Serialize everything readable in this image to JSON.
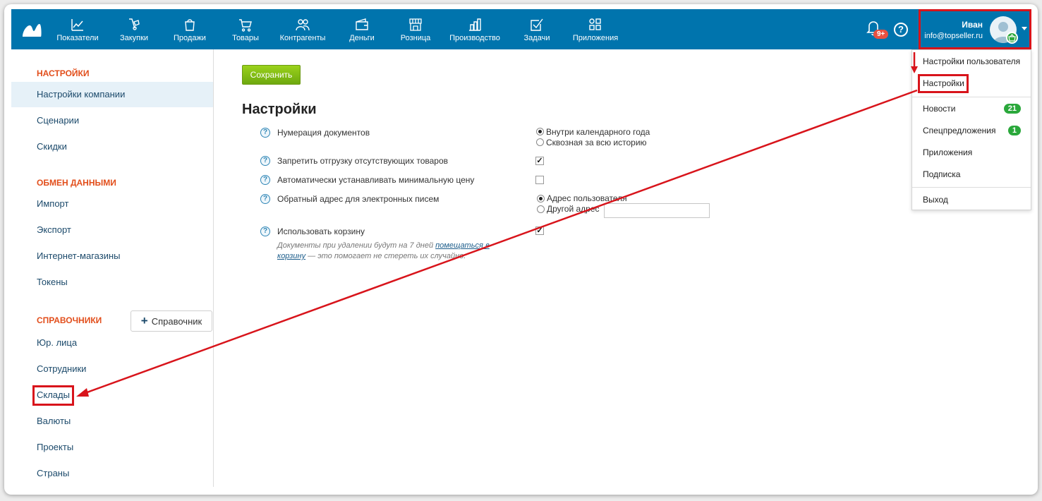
{
  "nav": {
    "items": [
      {
        "label": "Показатели",
        "icon": "chart-line-icon"
      },
      {
        "label": "Закупки",
        "icon": "hand-truck-icon"
      },
      {
        "label": "Продажи",
        "icon": "shopping-bag-icon"
      },
      {
        "label": "Товары",
        "icon": "cart-icon"
      },
      {
        "label": "Контрагенты",
        "icon": "people-icon"
      },
      {
        "label": "Деньги",
        "icon": "wallet-icon"
      },
      {
        "label": "Розница",
        "icon": "store-icon"
      },
      {
        "label": "Производство",
        "icon": "factory-icon"
      },
      {
        "label": "Задачи",
        "icon": "checkbox-icon"
      },
      {
        "label": "Приложения",
        "icon": "apps-icon"
      }
    ],
    "notifications_badge": "9+",
    "help_label": "?"
  },
  "user": {
    "name": "Иван",
    "email": "info@topseller.ru"
  },
  "user_menu": {
    "items": [
      {
        "label": "Настройки пользователя"
      },
      {
        "label": "Настройки"
      },
      {
        "label": "Новости",
        "badge": "21"
      },
      {
        "label": "Спецпредложения",
        "badge": "1"
      },
      {
        "label": "Приложения"
      },
      {
        "label": "Подписка"
      },
      {
        "label": "Выход"
      }
    ]
  },
  "sidebar": {
    "sections": [
      {
        "title": "НАСТРОЙКИ",
        "items": [
          "Настройки компании",
          "Сценарии",
          "Скидки"
        ]
      },
      {
        "title": "ОБМЕН ДАННЫМИ",
        "items": [
          "Импорт",
          "Экспорт",
          "Интернет-магазины",
          "Токены"
        ]
      },
      {
        "title": "СПРАВОЧНИКИ",
        "items": [
          "Юр. лица",
          "Сотрудники",
          "Склады",
          "Валюты",
          "Проекты",
          "Страны"
        ]
      }
    ],
    "add_reference_label": "Справочник",
    "active_item": "Настройки компании",
    "highlighted_item": "Склады"
  },
  "main": {
    "save_label": "Сохранить",
    "title": "Настройки",
    "settings": {
      "numbering": {
        "label": "Нумерация документов",
        "options": [
          "Внутри календарного года",
          "Сквозная за всю историю"
        ],
        "selected": "Внутри календарного года"
      },
      "forbid_shipping": {
        "label": "Запретить отгрузку отсутствующих товаров",
        "checked": true
      },
      "auto_min_price": {
        "label": "Автоматически устанавливать минимальную цену",
        "checked": false
      },
      "reply_address": {
        "label": "Обратный адрес для электронных писем",
        "options": [
          "Адрес пользователя",
          "Другой адрес"
        ],
        "selected": "Адрес пользователя",
        "other_value": ""
      },
      "use_trash": {
        "label": "Использовать корзину",
        "checked": true,
        "hint_before": "Документы при удалении будут на 7 дней ",
        "hint_link": "помещаться в корзину",
        "hint_after": " — это помогает не стереть их случайно."
      }
    }
  },
  "colors": {
    "topbar": "#0074ad",
    "section_title": "#e24e1b",
    "save_button": "#8cc21a",
    "annotation": "#d8141b",
    "badge_green": "#2aa83b",
    "badge_red": "#e85141"
  }
}
